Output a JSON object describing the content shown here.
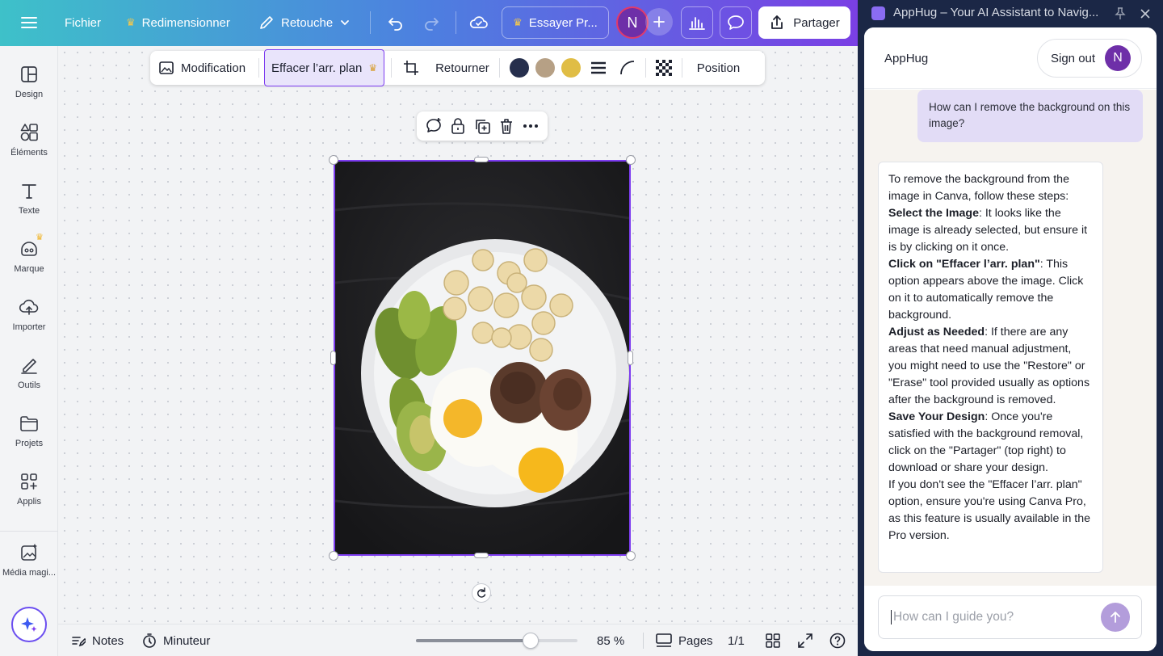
{
  "topbar": {
    "file": "Fichier",
    "resize": "Redimensionner",
    "retouch": "Retouche",
    "try_pro": "Essayer Pr...",
    "avatar_letter": "N",
    "share": "Partager"
  },
  "sidebar": {
    "items": [
      {
        "label": "Design",
        "icon": "layout-icon"
      },
      {
        "label": "Éléments",
        "icon": "shapes-icon"
      },
      {
        "label": "Texte",
        "icon": "text-icon"
      },
      {
        "label": "Marque",
        "icon": "brand-icon"
      },
      {
        "label": "Importer",
        "icon": "upload-cloud-icon"
      },
      {
        "label": "Outils",
        "icon": "pen-tool-icon"
      },
      {
        "label": "Projets",
        "icon": "folder-icon"
      },
      {
        "label": "Applis",
        "icon": "apps-grid-icon"
      },
      {
        "label": "Média magi...",
        "icon": "magic-media-icon"
      }
    ]
  },
  "context_toolbar": {
    "edit": "Modification",
    "bg_remove": "Effacer l’arr. plan",
    "flip": "Retourner",
    "position": "Position",
    "swatches": [
      "#262f4d",
      "#b6a085",
      "#e0bd45"
    ]
  },
  "bottombar": {
    "notes": "Notes",
    "timer": "Minuteur",
    "zoom": "85 %",
    "zoom_fraction": 0.71,
    "pages": "Pages",
    "page_count": "1/1"
  },
  "panel": {
    "window_title": "AppHug – Your AI Assistant to Navig...",
    "app_name": "AppHug",
    "sign_out": "Sign out",
    "avatar_letter": "N",
    "user_message": "How can I remove the background on this image?",
    "reply": {
      "intro": "To remove the background from the image in Canva, follow these steps:",
      "step1_title": "Select the Image",
      "step1_text": ": It looks like the image is already selected, but ensure it is by clicking on it once.",
      "step2_title": "Click on \"Effacer l’arr. plan\"",
      "step2_text": ": This option appears above the image. Click on it to automatically remove the background.",
      "step3_title": "Adjust as Needed",
      "step3_text": ": If there are any areas that need manual adjustment, you might need to use the \"Restore\" or \"Erase\" tool provided usually as options after the background is removed.",
      "step4_title": "Save Your Design",
      "step4_text": ": Once you're satisfied with the background removal, click on the \"Partager\" (top right) to download or share your design.",
      "outro": "If you don't see the \"Effacer l’arr. plan\" option, ensure you're using Canva Pro, as this feature is usually available in the Pro version."
    },
    "input_placeholder": "How can I guide you?"
  },
  "colors": {
    "accent_purple": "#7d3cf0",
    "avatar_purple": "#6e2fa8",
    "send_button": "#b39ddb"
  }
}
